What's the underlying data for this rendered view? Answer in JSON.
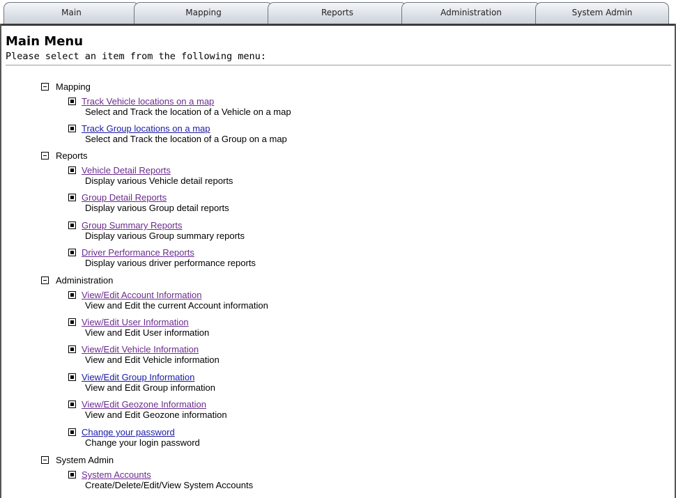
{
  "tabs": [
    {
      "label": "Main"
    },
    {
      "label": "Mapping"
    },
    {
      "label": "Reports"
    },
    {
      "label": "Administration"
    },
    {
      "label": "System Admin"
    }
  ],
  "header": {
    "title": "Main Menu",
    "subtitle": "Please select an item from the following menu:"
  },
  "sections": [
    {
      "label": "Mapping",
      "items": [
        {
          "link": "Track Vehicle locations on a map",
          "desc": "Select and Track the location of a Vehicle on a map"
        },
        {
          "link": "Track Group locations on a map",
          "desc": "Select and Track the location of a Group on a map"
        }
      ]
    },
    {
      "label": "Reports",
      "items": [
        {
          "link": "Vehicle Detail Reports",
          "desc": "Display various Vehicle detail reports"
        },
        {
          "link": "Group Detail Reports",
          "desc": "Display various Group detail reports"
        },
        {
          "link": "Group Summary Reports",
          "desc": "Display various Group summary reports"
        },
        {
          "link": "Driver Performance Reports",
          "desc": "Display various driver performance reports"
        }
      ]
    },
    {
      "label": "Administration",
      "items": [
        {
          "link": "View/Edit Account Information",
          "desc": "View and Edit the current Account information"
        },
        {
          "link": "View/Edit User Information",
          "desc": "View and Edit User information"
        },
        {
          "link": "View/Edit Vehicle Information",
          "desc": "View and Edit Vehicle information"
        },
        {
          "link": "View/Edit Group Information",
          "desc": "View and Edit Group information"
        },
        {
          "link": "View/Edit Geozone Information",
          "desc": "View and Edit Geozone information"
        },
        {
          "link": "Change your password",
          "desc": "Change your login password"
        }
      ]
    },
    {
      "label": "System Admin",
      "items": [
        {
          "link": "System Accounts",
          "desc": "Create/Delete/Edit/View System Accounts"
        }
      ]
    }
  ]
}
